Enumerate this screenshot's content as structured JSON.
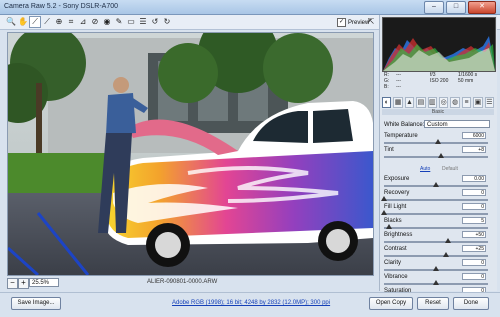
{
  "window": {
    "title": "Camera Raw 5.2 - Sony DSLR-A700"
  },
  "toolbar": {
    "tools": [
      "zoom-tool-icon",
      "hand-tool-icon",
      "white-balance-tool-icon",
      "color-sampler-tool-icon",
      "targeted-adjustment-tool-icon",
      "crop-tool-icon",
      "straighten-tool-icon",
      "spot-removal-tool-icon",
      "red-eye-removal-tool-icon",
      "adjustment-brush-icon",
      "graduated-filter-icon",
      "preferences-icon",
      "rotate-ccw-icon",
      "rotate-cw-icon"
    ],
    "preview_label": "Preview"
  },
  "image": {
    "filename": "ALIER-090801-0000.ARW"
  },
  "zoom": {
    "value": "25.5%"
  },
  "readout": {
    "r": "R:",
    "g": "G:",
    "b": "B:",
    "r_val": "---",
    "g_val": "---",
    "b_val": "---",
    "aperture": "f/3",
    "shutter": "1/1600 s",
    "iso": "ISO 200",
    "focal": "50 mm"
  },
  "section_title": "Basic",
  "white_balance": {
    "label": "White Balance:",
    "value": "Custom"
  },
  "sliders_top": [
    {
      "label": "Temperature",
      "value": "6000",
      "pos": 0.52
    },
    {
      "label": "Tint",
      "value": "+8",
      "pos": 0.55
    }
  ],
  "auto_label": "Auto",
  "default_label": "Default",
  "sliders_bottom": [
    {
      "label": "Exposure",
      "value": "0.00",
      "pos": 0.5
    },
    {
      "label": "Recovery",
      "value": "0",
      "pos": 0.0
    },
    {
      "label": "Fill Light",
      "value": "0",
      "pos": 0.0
    },
    {
      "label": "Blacks",
      "value": "5",
      "pos": 0.05
    },
    {
      "label": "Brightness",
      "value": "+50",
      "pos": 0.62
    },
    {
      "label": "Contrast",
      "value": "+25",
      "pos": 0.6
    },
    {
      "label": "Clarity",
      "value": "0",
      "pos": 0.5
    },
    {
      "label": "Vibrance",
      "value": "0",
      "pos": 0.5
    },
    {
      "label": "Saturation",
      "value": "0",
      "pos": 0.5
    }
  ],
  "buttons": {
    "save": "Save Image...",
    "open": "Open Copy",
    "reset": "Reset",
    "done": "Done"
  },
  "workflow_link": "Adobe RGB (1998); 16 bit; 4248 by 2832 (12.0MP); 300 ppi"
}
